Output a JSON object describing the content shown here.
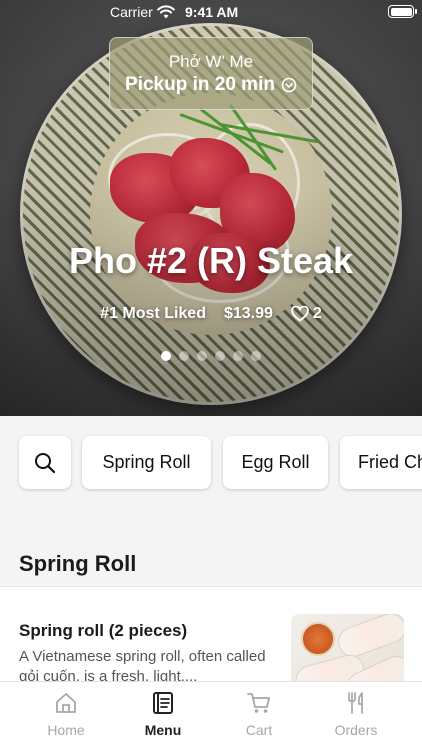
{
  "status_bar": {
    "carrier": "Carrier",
    "time": "9:41 AM"
  },
  "hero": {
    "store_name": "Phở W' Me",
    "pickup_eta": "Pickup in 20 min",
    "dish_title": "Pho #2 (R) Steak",
    "badge": "#1 Most Liked",
    "price": "$13.99",
    "like_count": "2",
    "carousel": {
      "total": 6,
      "active_index": 0
    }
  },
  "categories": {
    "search_icon": "search-icon",
    "chips": [
      "Spring Roll",
      "Egg Roll",
      "Fried Ch"
    ]
  },
  "section": {
    "title": "Spring Roll"
  },
  "menu_items": [
    {
      "name": "Spring roll (2 pieces)",
      "description": "A Vietnamese spring roll, often called gỏi cuốn, is a fresh, light...."
    }
  ],
  "tab_bar": {
    "tabs": [
      {
        "label": "Home",
        "icon": "home-icon",
        "active": false
      },
      {
        "label": "Menu",
        "icon": "menu-book-icon",
        "active": true
      },
      {
        "label": "Cart",
        "icon": "cart-icon",
        "active": false
      },
      {
        "label": "Orders",
        "icon": "fork-knife-icon",
        "active": false
      }
    ]
  },
  "colors": {
    "accent": "#222222",
    "inactive": "#a7a7a7",
    "background": "#f4f4f4"
  }
}
